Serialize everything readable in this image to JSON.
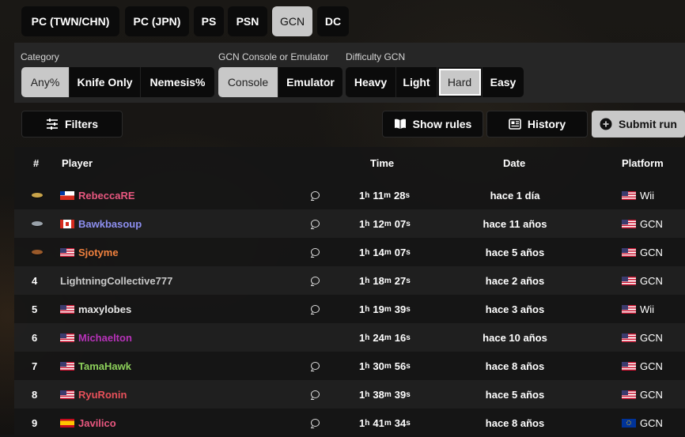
{
  "platform_tabs": [
    "PC (TWN/CHN)",
    "PC (JPN)",
    "PS",
    "PSN",
    "GCN",
    "DC"
  ],
  "filters": {
    "category_label": "Category",
    "category_options": [
      "Any%",
      "Knife Only",
      "Nemesis%"
    ],
    "console_label": "GCN Console or Emulator",
    "console_options": [
      "Console",
      "Emulator"
    ],
    "difficulty_label": "Difficulty GCN",
    "difficulty_options": [
      "Heavy",
      "Light",
      "Hard",
      "Easy"
    ]
  },
  "toolbar": {
    "filters_label": "Filters",
    "show_rules_label": "Show rules",
    "history_label": "History",
    "submit_label": "Submit run"
  },
  "table": {
    "headers": {
      "rank": "#",
      "player": "Player",
      "time": "Time",
      "date": "Date",
      "platform": "Platform"
    },
    "rows": [
      {
        "rank": "",
        "medal": "gold",
        "flag": "cl",
        "player": "RebeccaRE",
        "color": "#e8577f",
        "comment": true,
        "h": "1",
        "m": "11",
        "s": "28",
        "date": "hace 1 día",
        "pflag": "us",
        "platform": "Wii"
      },
      {
        "rank": "",
        "medal": "silver",
        "flag": "ca",
        "player": "Bawkbasoup",
        "color": "#8d8ff0",
        "comment": true,
        "h": "1",
        "m": "12",
        "s": "07",
        "date": "hace 11 años",
        "pflag": "us",
        "platform": "GCN"
      },
      {
        "rank": "",
        "medal": "bronze",
        "flag": "us",
        "player": "Sjotyme",
        "color": "#f0813e",
        "comment": true,
        "h": "1",
        "m": "14",
        "s": "07",
        "date": "hace 5 años",
        "pflag": "us",
        "platform": "GCN"
      },
      {
        "rank": "4",
        "medal": "",
        "flag": "",
        "player": "LightningCollective777",
        "color": "#c8c8c8",
        "comment": true,
        "h": "1",
        "m": "18",
        "s": "27",
        "date": "hace 2 años",
        "pflag": "us",
        "platform": "GCN"
      },
      {
        "rank": "5",
        "medal": "",
        "flag": "us",
        "player": "maxylobes",
        "color": "#e6e6e6",
        "comment": true,
        "h": "1",
        "m": "19",
        "s": "39",
        "date": "hace 3 años",
        "pflag": "us",
        "platform": "Wii"
      },
      {
        "rank": "6",
        "medal": "",
        "flag": "us",
        "player": "Michaelton",
        "color": "#b632b8",
        "comment": false,
        "h": "1",
        "m": "24",
        "s": "16",
        "date": "hace 10 años",
        "pflag": "us",
        "platform": "GCN"
      },
      {
        "rank": "7",
        "medal": "",
        "flag": "us",
        "player": "TamaHawk",
        "color": "#8ccf5a",
        "comment": true,
        "h": "1",
        "m": "30",
        "s": "56",
        "date": "hace 8 años",
        "pflag": "us",
        "platform": "GCN"
      },
      {
        "rank": "8",
        "medal": "",
        "flag": "us",
        "player": "RyuRonin",
        "color": "#e8505a",
        "comment": true,
        "h": "1",
        "m": "38",
        "s": "39",
        "date": "hace 5 años",
        "pflag": "us",
        "platform": "GCN"
      },
      {
        "rank": "9",
        "medal": "",
        "flag": "es",
        "player": "Javilico",
        "color": "#e8577f",
        "comment": true,
        "h": "1",
        "m": "41",
        "s": "34",
        "date": "hace 8 años",
        "pflag": "eu",
        "platform": "GCN"
      }
    ]
  }
}
